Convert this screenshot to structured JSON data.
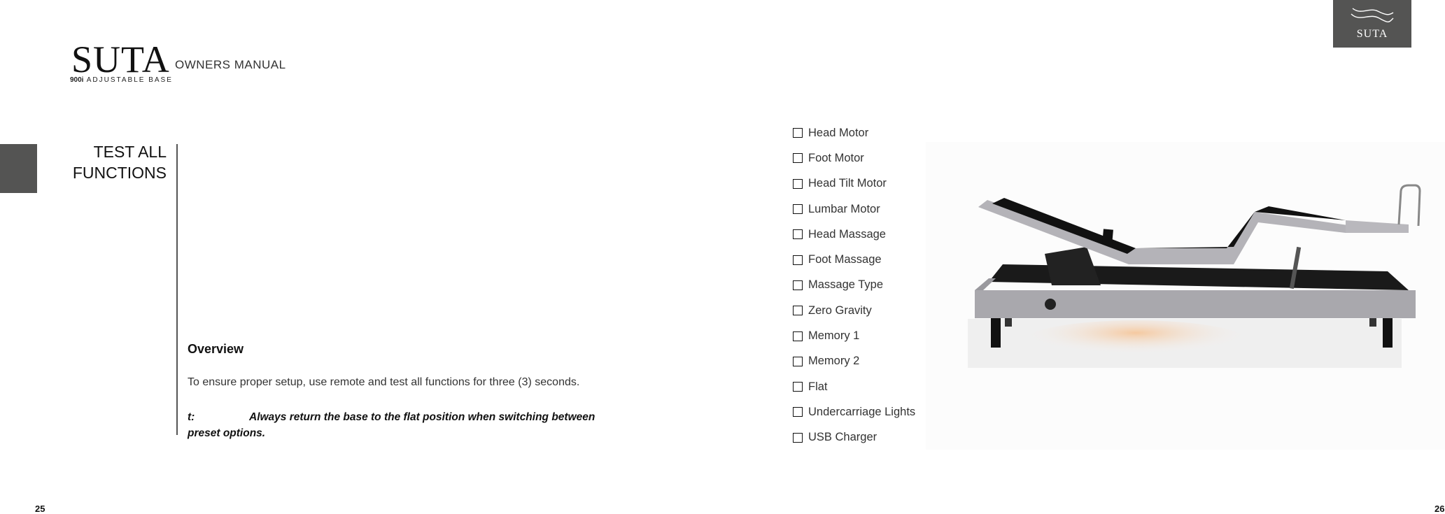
{
  "header": {
    "brand": "SUTA",
    "subtitle": "OWNERS MANUAL",
    "model_number": "900i",
    "model_label": "ADJUSTABLE BASE"
  },
  "badge": {
    "brand": "SUTA",
    "icon": "wave-logo-icon",
    "background": "#545453"
  },
  "section": {
    "title_line1": "TEST ALL",
    "title_line2": "FUNCTIONS"
  },
  "overview": {
    "heading": "Overview",
    "body": "To ensure proper setup, use remote and test all functions for three (3) seconds.",
    "tip_label": "t:",
    "tip_text": "Always return the base to the flat position when switching between preset options."
  },
  "checklist": [
    {
      "label": "Head Motor",
      "checked": false
    },
    {
      "label": "Foot Motor",
      "checked": false
    },
    {
      "label": "Head Tilt Motor",
      "checked": false
    },
    {
      "label": "Lumbar Motor",
      "checked": false
    },
    {
      "label": "Head Massage",
      "checked": false
    },
    {
      "label": "Foot Massage",
      "checked": false
    },
    {
      "label": "Massage Type",
      "checked": false
    },
    {
      "label": "Zero Gravity",
      "checked": false
    },
    {
      "label": "Memory 1",
      "checked": false
    },
    {
      "label": "Memory 2",
      "checked": false
    },
    {
      "label": "Flat",
      "checked": false
    },
    {
      "label": "Undercarriage Lights",
      "checked": false
    },
    {
      "label": "USB Charger",
      "checked": false
    }
  ],
  "image": {
    "subject": "adjustable-bed-base-photo"
  },
  "pages": {
    "left": "25",
    "right": "26"
  }
}
